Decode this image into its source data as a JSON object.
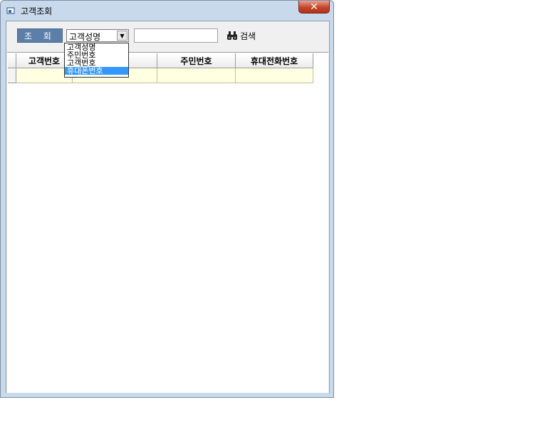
{
  "window": {
    "title": "고객조회",
    "close_label": "✕"
  },
  "toolbar": {
    "query_button_label": "조 회",
    "search_field": {
      "selected": "고객성명",
      "options": [
        "고객성명",
        "주민번호",
        "고객번호",
        "휴대폰번호"
      ],
      "highlighted_option": "휴대폰번호"
    },
    "search_input_value": "",
    "search_button_label": "검색",
    "search_icon": "binoculars-icon"
  },
  "grid": {
    "columns": [
      "고객번호",
      "",
      "주민번호",
      "휴대전화번호"
    ],
    "rows": [
      [
        "",
        "",
        "",
        ""
      ]
    ],
    "row_color": "#ffffe1"
  },
  "colors": {
    "query_button": "#5b7fa8",
    "close_button": "#c7442a",
    "window_frame": "#c9d9ec",
    "dropdown_highlight": "#3399ff"
  }
}
